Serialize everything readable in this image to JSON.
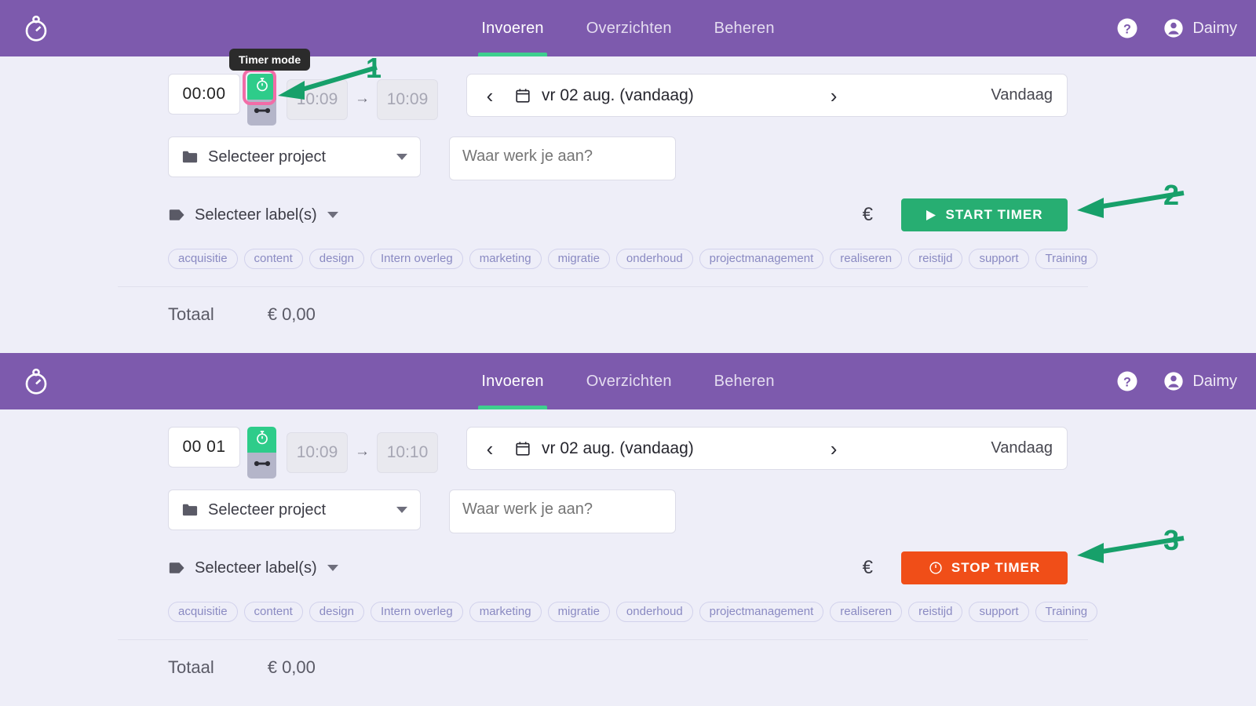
{
  "app": {
    "logo_icon": "stopwatch-icon",
    "accent_purple": "#7d5aad",
    "accent_green": "#27ae72",
    "accent_orange": "#f04e18",
    "background": "#eeeef8"
  },
  "nav": {
    "items": [
      {
        "label": "Invoeren",
        "active": true
      },
      {
        "label": "Overzichten",
        "active": false
      },
      {
        "label": "Beheren",
        "active": false
      }
    ],
    "help_icon": "question-circle-icon",
    "user_icon": "account-circle-icon",
    "user_name": "Daimy"
  },
  "tooltip": {
    "text": "Timer mode"
  },
  "panel_top": {
    "duration": "00:00",
    "mode_toggle": {
      "timer_icon": "stopwatch-icon",
      "range_icon": "arrows-horizontal-icon",
      "highlighted": true
    },
    "start_time": "10:09",
    "time_arrow": "→",
    "end_time": "10:09",
    "date": {
      "prev_icon": "chevron-left-icon",
      "calendar_icon": "calendar-icon",
      "text": "vr 02 aug. (vandaag)",
      "next_icon": "chevron-right-icon",
      "today_label": "Vandaag"
    },
    "project": {
      "icon": "folder-icon",
      "text": "Selecteer project",
      "caret": "chevron-down-icon"
    },
    "description_placeholder": "Waar werk je aan?",
    "labels_select": {
      "icon": "tag-icon",
      "text": "Selecteer label(s)",
      "caret": "chevron-down-icon"
    },
    "euro_icon": "€",
    "action_button": {
      "label": "START TIMER",
      "icon": "play-icon",
      "style": "start"
    },
    "chips": [
      "acquisitie",
      "content",
      "design",
      "Intern overleg",
      "marketing",
      "migratie",
      "onderhoud",
      "projectmanagement",
      "realiseren",
      "reistijd",
      "support",
      "Training"
    ],
    "total_label": "Totaal",
    "total_amount": "€ 0,00"
  },
  "panel_bottom": {
    "duration": "00 01",
    "mode_toggle": {
      "timer_icon": "stopwatch-icon",
      "range_icon": "arrows-horizontal-icon",
      "highlighted": false
    },
    "start_time": "10:09",
    "time_arrow": "→",
    "end_time": "10:10",
    "date": {
      "prev_icon": "chevron-left-icon",
      "calendar_icon": "calendar-icon",
      "text": "vr 02 aug. (vandaag)",
      "next_icon": "chevron-right-icon",
      "today_label": "Vandaag"
    },
    "project": {
      "icon": "folder-icon",
      "text": "Selecteer project",
      "caret": "chevron-down-icon"
    },
    "description_placeholder": "Waar werk je aan?",
    "labels_select": {
      "icon": "tag-icon",
      "text": "Selecteer label(s)",
      "caret": "chevron-down-icon"
    },
    "euro_icon": "€",
    "action_button": {
      "label": "STOP TIMER",
      "icon": "timer-circle-icon",
      "style": "stop"
    },
    "chips": [
      "acquisitie",
      "content",
      "design",
      "Intern overleg",
      "marketing",
      "migratie",
      "onderhoud",
      "projectmanagement",
      "realiseren",
      "reistijd",
      "support",
      "Training"
    ],
    "total_label": "Totaal",
    "total_amount": "€ 0,00"
  },
  "annotations": [
    {
      "number": "1",
      "color": "#17a06a",
      "target": "timer-mode-toggle"
    },
    {
      "number": "2",
      "color": "#17a06a",
      "target": "start-timer-button"
    },
    {
      "number": "3",
      "color": "#17a06a",
      "target": "stop-timer-button"
    }
  ]
}
